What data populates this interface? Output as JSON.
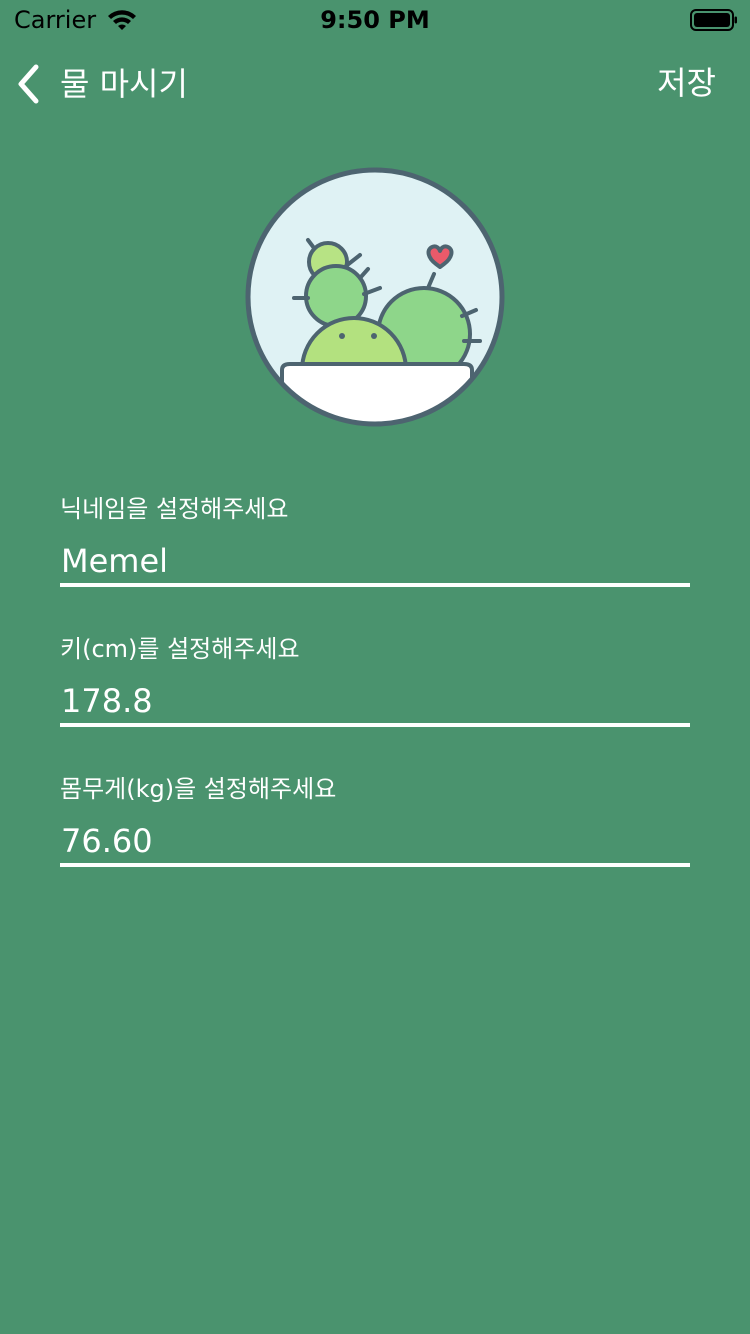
{
  "colors": {
    "background": "#4a936e",
    "foreground": "#ffffff"
  },
  "status_bar": {
    "carrier": "Carrier",
    "time": "9:50 PM",
    "icons": [
      "wifi-icon",
      "battery-icon"
    ]
  },
  "nav": {
    "back_icon": "chevron-left-icon",
    "title": "물 마시기",
    "save_label": "저장"
  },
  "avatar": {
    "icon": "cactus-icon"
  },
  "form": {
    "nickname": {
      "label": "닉네임을 설정해주세요",
      "value": "Memel"
    },
    "height": {
      "label": "키(cm)를 설정해주세요",
      "value": "178.8"
    },
    "weight": {
      "label": "몸무게(kg)을 설정해주세요",
      "value": "76.60"
    }
  }
}
